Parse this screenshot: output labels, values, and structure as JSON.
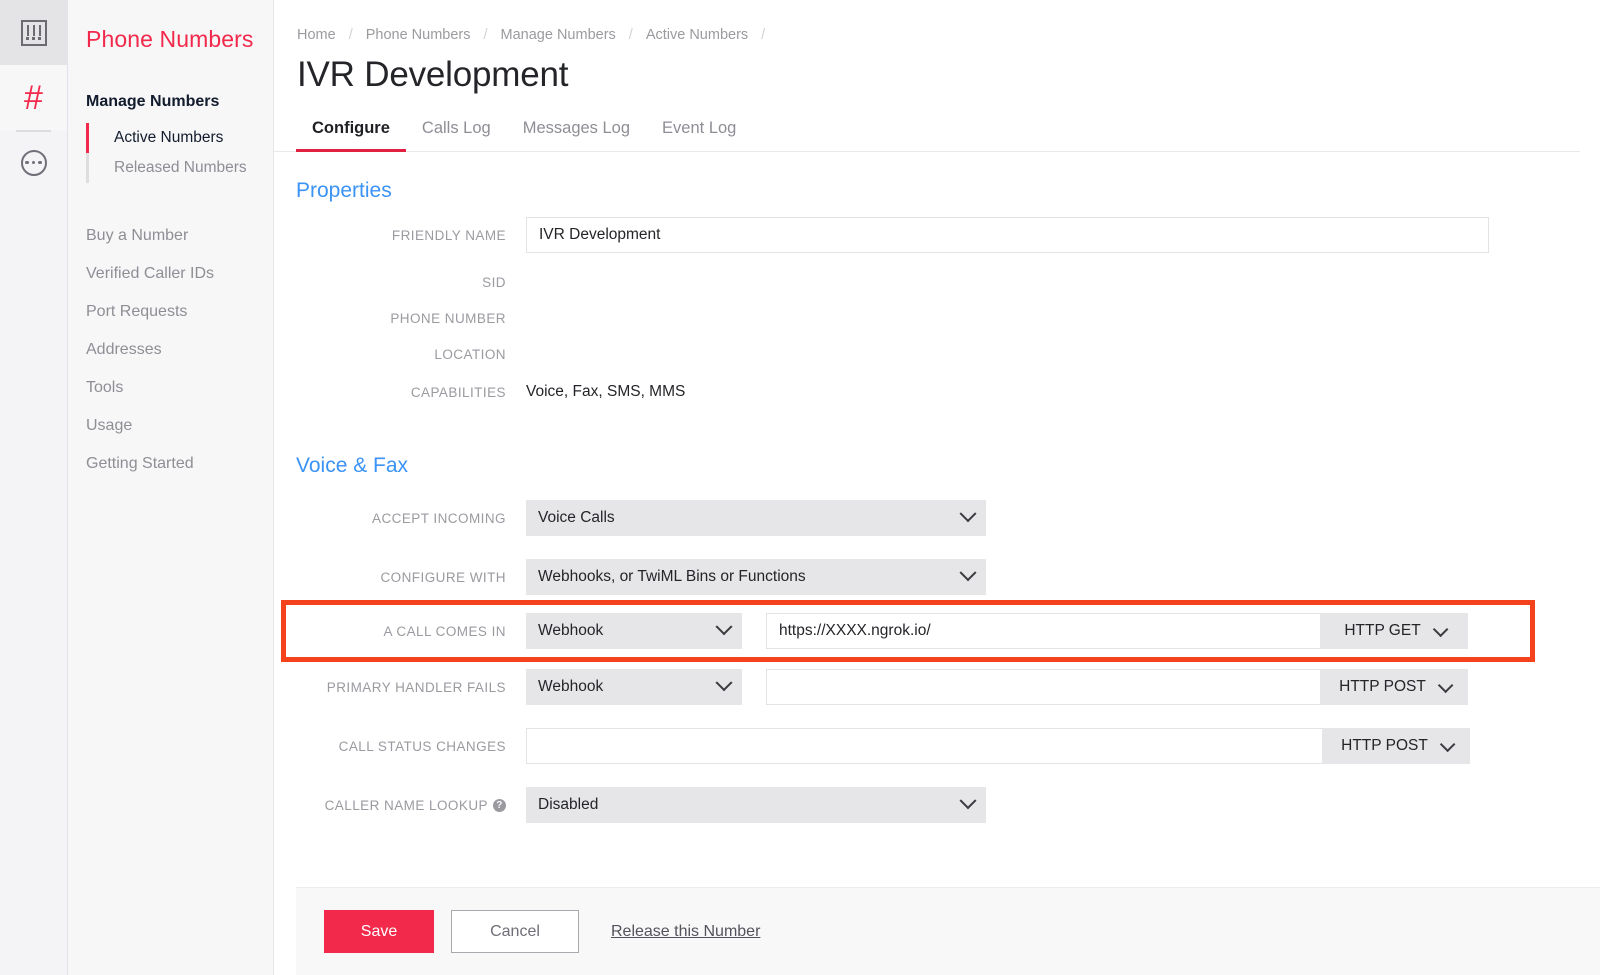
{
  "rail": {
    "items": [
      {
        "icon": "console-icon",
        "name": "console"
      },
      {
        "icon": "hash-icon",
        "name": "phone-numbers"
      },
      {
        "icon": "more-dots-icon",
        "name": "more"
      }
    ]
  },
  "sidebar": {
    "title": "Phone Numbers",
    "section_label": "Manage Numbers",
    "sub_items": [
      {
        "label": "Active Numbers",
        "active": true
      },
      {
        "label": "Released Numbers",
        "active": false
      }
    ],
    "nav_items": [
      {
        "label": "Buy a Number"
      },
      {
        "label": "Verified Caller IDs"
      },
      {
        "label": "Port Requests"
      },
      {
        "label": "Addresses"
      },
      {
        "label": "Tools"
      },
      {
        "label": "Usage"
      },
      {
        "label": "Getting Started"
      }
    ]
  },
  "breadcrumb": {
    "items": [
      "Home",
      "Phone Numbers",
      "Manage Numbers",
      "Active Numbers"
    ],
    "separator": "/"
  },
  "page": {
    "title": "IVR Development"
  },
  "tabs": [
    {
      "label": "Configure",
      "active": true
    },
    {
      "label": "Calls Log",
      "active": false
    },
    {
      "label": "Messages Log",
      "active": false
    },
    {
      "label": "Event Log",
      "active": false
    }
  ],
  "properties": {
    "heading": "Properties",
    "friendly_name_label": "FRIENDLY NAME",
    "friendly_name_value": "IVR Development",
    "sid_label": "SID",
    "sid_value": "",
    "phone_number_label": "PHONE NUMBER",
    "phone_number_value": "",
    "location_label": "LOCATION",
    "location_value": "",
    "capabilities_label": "CAPABILITIES",
    "capabilities_value": "Voice, Fax, SMS, MMS"
  },
  "voice_fax": {
    "heading": "Voice & Fax",
    "accept_incoming_label": "ACCEPT INCOMING",
    "accept_incoming_value": "Voice Calls",
    "configure_with_label": "CONFIGURE WITH",
    "configure_with_value": "Webhooks, or TwiML Bins or Functions",
    "a_call_comes_in_label": "A CALL COMES IN",
    "a_call_comes_in_type": "Webhook",
    "a_call_comes_in_url": "https://XXXX.ngrok.io/",
    "a_call_comes_in_method": "HTTP GET",
    "primary_handler_fails_label": "PRIMARY HANDLER FAILS",
    "primary_handler_fails_type": "Webhook",
    "primary_handler_fails_url": "",
    "primary_handler_fails_method": "HTTP POST",
    "call_status_changes_label": "CALL STATUS CHANGES",
    "call_status_changes_url": "",
    "call_status_changes_method": "HTTP POST",
    "caller_name_lookup_label": "CALLER NAME LOOKUP",
    "caller_name_lookup_help": "?",
    "caller_name_lookup_value": "Disabled"
  },
  "actions": {
    "save_label": "Save",
    "cancel_label": "Cancel",
    "release_label": "Release this Number"
  },
  "colors": {
    "brand_red": "#F2294B",
    "highlight_orange": "#F4431C",
    "section_blue": "#3A93F5",
    "tab_underline": "#E2203F"
  }
}
